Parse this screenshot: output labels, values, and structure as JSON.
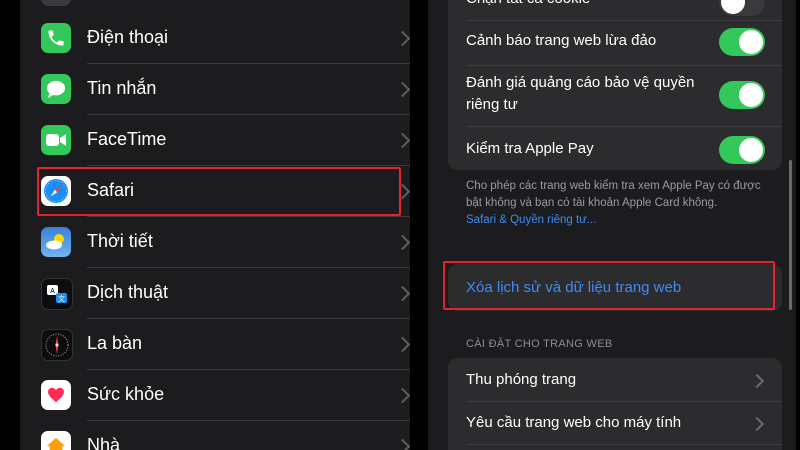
{
  "settings_list": {
    "items": [
      {
        "label": "Điện thoại",
        "icon": "phone-icon"
      },
      {
        "label": "Tin nhắn",
        "icon": "messages-icon"
      },
      {
        "label": "FaceTime",
        "icon": "facetime-icon"
      },
      {
        "label": "Safari",
        "icon": "safari-icon"
      },
      {
        "label": "Thời tiết",
        "icon": "weather-icon"
      },
      {
        "label": "Dịch thuật",
        "icon": "translate-icon"
      },
      {
        "label": "La bàn",
        "icon": "compass-icon"
      },
      {
        "label": "Sức khỏe",
        "icon": "health-icon"
      },
      {
        "label": "Nhà",
        "icon": "home-icon"
      }
    ]
  },
  "safari_settings": {
    "privacy_toggles": [
      {
        "label": "Chặn tất cả cookie",
        "on": false
      },
      {
        "label": "Cảnh báo trang web lừa đảo",
        "on": true
      },
      {
        "label": "Đánh giá quảng cáo bảo vệ quyền riêng tư",
        "on": true
      },
      {
        "label": "Kiểm tra Apple Pay",
        "on": true
      }
    ],
    "apple_pay_note": "Cho phép các trang web kiểm tra xem Apple Pay có được bật không và bạn có tài khoản Apple Card không.",
    "privacy_link": "Safari & Quyền riêng tư...",
    "clear_history_label": "Xóa lịch sử và dữ liệu trang web",
    "website_settings_header": "CÀI ĐẶT CHO TRANG WEB",
    "website_settings": [
      {
        "label": "Thu phóng trang"
      },
      {
        "label": "Yêu cầu trang web cho máy tính"
      }
    ]
  },
  "colors": {
    "highlight_box": "#e0252c",
    "toggle_on": "#34c759",
    "link_blue": "#3d8cf5",
    "background": "#1c1c1e"
  }
}
